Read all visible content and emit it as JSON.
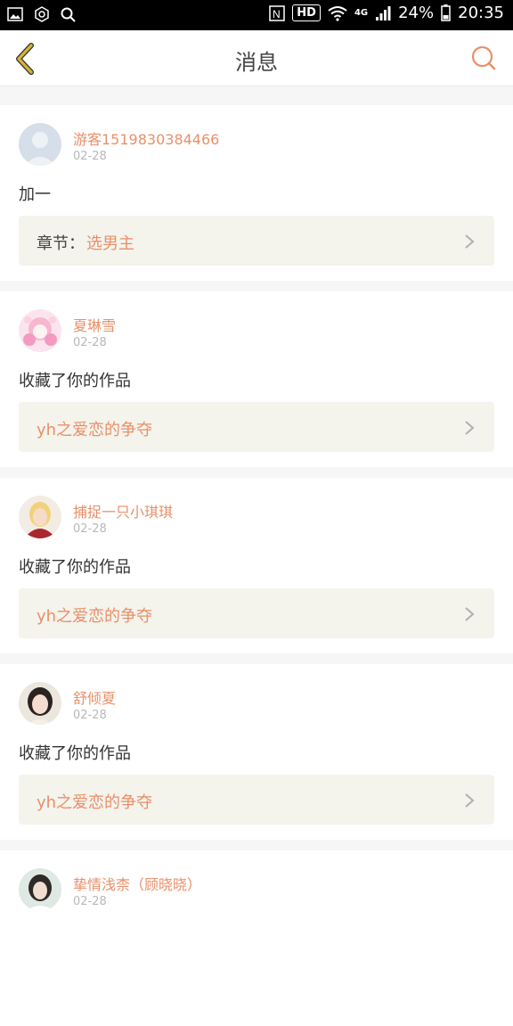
{
  "status_bar": {
    "hd": "HD",
    "net": "4G",
    "battery": "24%",
    "time": "20:35"
  },
  "header": {
    "title": "消息"
  },
  "messages": [
    {
      "user": "游客1519830384466",
      "date": "02-28",
      "content": "加一",
      "link_prefix": "章节：",
      "link_text": "选男主"
    },
    {
      "user": "夏琳雪",
      "date": "02-28",
      "content": "收藏了你的作品",
      "link_prefix": "",
      "link_text": "yh之爱恋的争夺"
    },
    {
      "user": "捕捉一只小琪琪",
      "date": "02-28",
      "content": "收藏了你的作品",
      "link_prefix": "",
      "link_text": "yh之爱恋的争夺"
    },
    {
      "user": "舒倾夏",
      "date": "02-28",
      "content": "收藏了你的作品",
      "link_prefix": "",
      "link_text": "yh之爱恋的争夺"
    },
    {
      "user": "挚情浅柰（顾晓晓）",
      "date": "02-28",
      "content": "",
      "link_prefix": "",
      "link_text": ""
    }
  ],
  "colors": {
    "accent": "#e8906a",
    "back_arrow": "#c8a12a",
    "link_bg": "#f4f3ec"
  }
}
